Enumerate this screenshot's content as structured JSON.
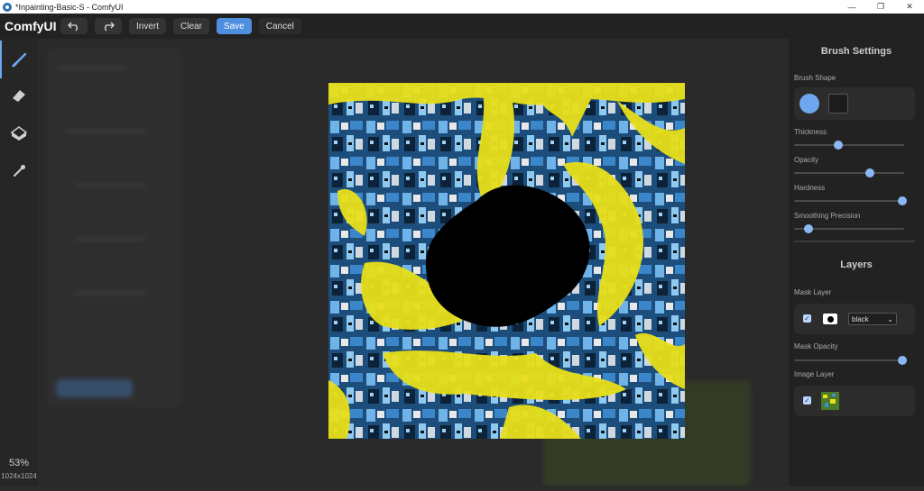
{
  "window": {
    "title": "*Inpainting-Basic-S - ComfyUI",
    "minimize": "—",
    "maximize": "❐",
    "close": "✕"
  },
  "toolbar": {
    "brand": "ComfyUI",
    "undo_icon": "undo-icon",
    "redo_icon": "redo-icon",
    "invert_label": "Invert",
    "clear_label": "Clear",
    "save_label": "Save",
    "cancel_label": "Cancel"
  },
  "tools": [
    "brush-icon",
    "eraser-icon",
    "paint-bucket-icon",
    "color-picker-icon"
  ],
  "status": {
    "zoom": "53%",
    "dimensions": "1024x1024"
  },
  "brush_settings": {
    "title": "Brush Settings",
    "shape_label": "Brush Shape",
    "thickness_label": "Thickness",
    "thickness": 0.4,
    "opacity_label": "Opacity",
    "opacity": 0.69,
    "hardness_label": "Hardness",
    "hardness": 0.98,
    "smoothing_label": "Smoothing Precision",
    "smoothing": 0.13
  },
  "layers": {
    "title": "Layers",
    "mask_layer_label": "Mask Layer",
    "mask_color": "black",
    "mask_opacity_label": "Mask Opacity",
    "mask_opacity": 0.98,
    "image_layer_label": "Image Layer"
  },
  "colors": {
    "accent": "#4e8fe0",
    "slider_knob": "#8ab8f5",
    "image_yellow": "#e8df1a",
    "image_blue": "#3f8fd8"
  }
}
